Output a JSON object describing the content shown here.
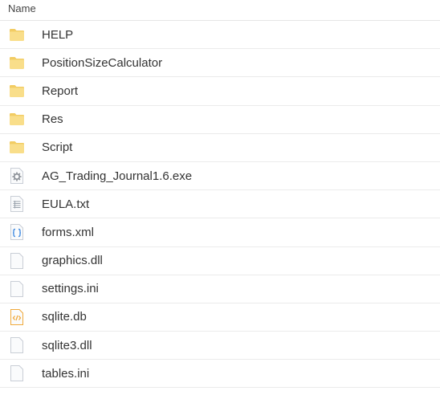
{
  "header": {
    "name_label": "Name"
  },
  "colors": {
    "folder_fill": "#F9DE8A",
    "folder_tab": "#F2CC63",
    "file_outline": "#C9CED6",
    "xml_blue": "#4A90E2",
    "db_orange": "#F0A93B",
    "exe_gray": "#8A8F96",
    "row_divider": "#EBEBEB"
  },
  "files": [
    {
      "name": "HELP",
      "icon": "folder-icon"
    },
    {
      "name": "PositionSizeCalculator",
      "icon": "folder-icon"
    },
    {
      "name": "Report",
      "icon": "folder-icon"
    },
    {
      "name": "Res",
      "icon": "folder-icon"
    },
    {
      "name": "Script",
      "icon": "folder-icon"
    },
    {
      "name": "AG_Trading_Journal1.6.exe",
      "icon": "executable-icon"
    },
    {
      "name": "EULA.txt",
      "icon": "text-file-icon"
    },
    {
      "name": "forms.xml",
      "icon": "code-file-icon"
    },
    {
      "name": "graphics.dll",
      "icon": "blank-file-icon"
    },
    {
      "name": "settings.ini",
      "icon": "blank-file-icon"
    },
    {
      "name": "sqlite.db",
      "icon": "source-file-icon"
    },
    {
      "name": "sqlite3.dll",
      "icon": "blank-file-icon"
    },
    {
      "name": "tables.ini",
      "icon": "blank-file-icon"
    }
  ]
}
